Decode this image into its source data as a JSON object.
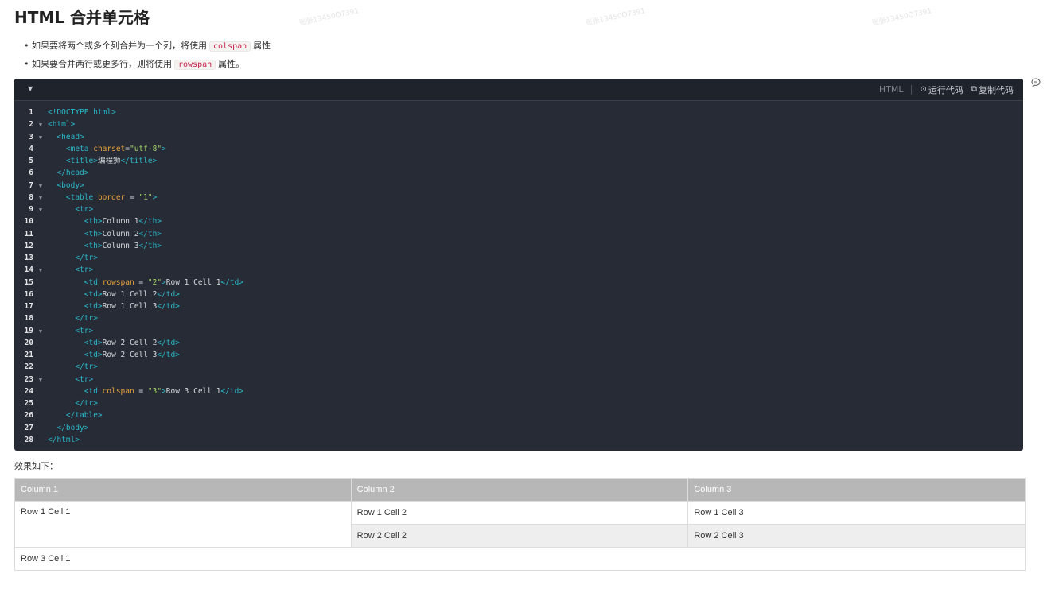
{
  "page": {
    "title": "HTML 合并单元格",
    "bullets": [
      {
        "prefix": "如果要将两个或多个列合并为一个列，将使用",
        "code": "colspan",
        "suffix": "属性"
      },
      {
        "prefix": "如果要合并两行或更多行，则将使用",
        "code": "rowspan",
        "suffix": "属性。"
      }
    ],
    "effect_label": "效果如下："
  },
  "code_block": {
    "language": "HTML",
    "run_label": "运行代码",
    "copy_label": "复制代码",
    "lines": [
      {
        "n": "1",
        "fold": false,
        "indent": "",
        "tokens": [
          {
            "t": "doct",
            "v": "<!DOCTYPE html>"
          }
        ]
      },
      {
        "n": "2",
        "fold": true,
        "indent": "",
        "tokens": [
          {
            "t": "tag",
            "v": "<html>"
          }
        ]
      },
      {
        "n": "3",
        "fold": true,
        "indent": "  ",
        "tokens": [
          {
            "t": "tag",
            "v": "<head>"
          }
        ]
      },
      {
        "n": "4",
        "fold": false,
        "indent": "    ",
        "tokens": [
          {
            "t": "tag",
            "v": "<meta "
          },
          {
            "t": "attr",
            "v": "charset"
          },
          {
            "t": "ct",
            "v": "="
          },
          {
            "t": "str",
            "v": "\"utf-8\""
          },
          {
            "t": "tag",
            "v": ">"
          }
        ]
      },
      {
        "n": "5",
        "fold": false,
        "indent": "    ",
        "tokens": [
          {
            "t": "tag",
            "v": "<title>"
          },
          {
            "t": "ct",
            "v": "编程狮"
          },
          {
            "t": "tag",
            "v": "</title>"
          }
        ]
      },
      {
        "n": "6",
        "fold": false,
        "indent": "  ",
        "tokens": [
          {
            "t": "tag",
            "v": "</head>"
          }
        ]
      },
      {
        "n": "7",
        "fold": true,
        "indent": "  ",
        "tokens": [
          {
            "t": "tag",
            "v": "<body>"
          }
        ]
      },
      {
        "n": "8",
        "fold": true,
        "indent": "    ",
        "tokens": [
          {
            "t": "tag",
            "v": "<table "
          },
          {
            "t": "attr",
            "v": "border"
          },
          {
            "t": "ct",
            "v": " = "
          },
          {
            "t": "str",
            "v": "\"1\""
          },
          {
            "t": "tag",
            "v": ">"
          }
        ]
      },
      {
        "n": "9",
        "fold": true,
        "indent": "      ",
        "tokens": [
          {
            "t": "tag",
            "v": "<tr>"
          }
        ]
      },
      {
        "n": "10",
        "fold": false,
        "indent": "        ",
        "tokens": [
          {
            "t": "tag",
            "v": "<th>"
          },
          {
            "t": "ct",
            "v": "Column 1"
          },
          {
            "t": "tag",
            "v": "</th>"
          }
        ]
      },
      {
        "n": "11",
        "fold": false,
        "indent": "        ",
        "tokens": [
          {
            "t": "tag",
            "v": "<th>"
          },
          {
            "t": "ct",
            "v": "Column 2"
          },
          {
            "t": "tag",
            "v": "</th>"
          }
        ]
      },
      {
        "n": "12",
        "fold": false,
        "indent": "        ",
        "tokens": [
          {
            "t": "tag",
            "v": "<th>"
          },
          {
            "t": "ct",
            "v": "Column 3"
          },
          {
            "t": "tag",
            "v": "</th>"
          }
        ]
      },
      {
        "n": "13",
        "fold": false,
        "indent": "      ",
        "tokens": [
          {
            "t": "tag",
            "v": "</tr>"
          }
        ]
      },
      {
        "n": "14",
        "fold": true,
        "indent": "      ",
        "tokens": [
          {
            "t": "tag",
            "v": "<tr>"
          }
        ]
      },
      {
        "n": "15",
        "fold": false,
        "indent": "        ",
        "tokens": [
          {
            "t": "tag",
            "v": "<td "
          },
          {
            "t": "attr",
            "v": "rowspan"
          },
          {
            "t": "ct",
            "v": " = "
          },
          {
            "t": "str",
            "v": "\"2\""
          },
          {
            "t": "tag",
            "v": ">"
          },
          {
            "t": "ct",
            "v": "Row 1 Cell 1"
          },
          {
            "t": "tag",
            "v": "</td>"
          }
        ]
      },
      {
        "n": "16",
        "fold": false,
        "indent": "        ",
        "tokens": [
          {
            "t": "tag",
            "v": "<td>"
          },
          {
            "t": "ct",
            "v": "Row 1 Cell 2"
          },
          {
            "t": "tag",
            "v": "</td>"
          }
        ]
      },
      {
        "n": "17",
        "fold": false,
        "indent": "        ",
        "tokens": [
          {
            "t": "tag",
            "v": "<td>"
          },
          {
            "t": "ct",
            "v": "Row 1 Cell 3"
          },
          {
            "t": "tag",
            "v": "</td>"
          }
        ]
      },
      {
        "n": "18",
        "fold": false,
        "indent": "      ",
        "tokens": [
          {
            "t": "tag",
            "v": "</tr>"
          }
        ]
      },
      {
        "n": "19",
        "fold": true,
        "indent": "      ",
        "tokens": [
          {
            "t": "tag",
            "v": "<tr>"
          }
        ]
      },
      {
        "n": "20",
        "fold": false,
        "indent": "        ",
        "tokens": [
          {
            "t": "tag",
            "v": "<td>"
          },
          {
            "t": "ct",
            "v": "Row 2 Cell 2"
          },
          {
            "t": "tag",
            "v": "</td>"
          }
        ]
      },
      {
        "n": "21",
        "fold": false,
        "indent": "        ",
        "tokens": [
          {
            "t": "tag",
            "v": "<td>"
          },
          {
            "t": "ct",
            "v": "Row 2 Cell 3"
          },
          {
            "t": "tag",
            "v": "</td>"
          }
        ]
      },
      {
        "n": "22",
        "fold": false,
        "indent": "      ",
        "tokens": [
          {
            "t": "tag",
            "v": "</tr>"
          }
        ]
      },
      {
        "n": "23",
        "fold": true,
        "indent": "      ",
        "tokens": [
          {
            "t": "tag",
            "v": "<tr>"
          }
        ]
      },
      {
        "n": "24",
        "fold": false,
        "indent": "        ",
        "tokens": [
          {
            "t": "tag",
            "v": "<td "
          },
          {
            "t": "attr",
            "v": "colspan"
          },
          {
            "t": "ct",
            "v": " = "
          },
          {
            "t": "str",
            "v": "\"3\""
          },
          {
            "t": "tag",
            "v": ">"
          },
          {
            "t": "ct",
            "v": "Row 3 Cell 1"
          },
          {
            "t": "tag",
            "v": "</td>"
          }
        ]
      },
      {
        "n": "25",
        "fold": false,
        "indent": "      ",
        "tokens": [
          {
            "t": "tag",
            "v": "</tr>"
          }
        ]
      },
      {
        "n": "26",
        "fold": false,
        "indent": "    ",
        "tokens": [
          {
            "t": "tag",
            "v": "</table>"
          }
        ]
      },
      {
        "n": "27",
        "fold": false,
        "indent": "  ",
        "tokens": [
          {
            "t": "tag",
            "v": "</body>"
          }
        ]
      },
      {
        "n": "28",
        "fold": false,
        "indent": "",
        "tokens": [
          {
            "t": "tag",
            "v": "</html>"
          }
        ]
      }
    ]
  },
  "demo_table": {
    "headers": [
      "Column 1",
      "Column 2",
      "Column 3"
    ],
    "r1c1": "Row 1 Cell 1",
    "r1c2": "Row 1 Cell 2",
    "r1c3": "Row 1 Cell 3",
    "r2c2": "Row 2 Cell 2",
    "r2c3": "Row 2 Cell 3",
    "r3c1": "Row 3 Cell 1"
  },
  "watermark_text": "张张13450O7391",
  "colors": {
    "code_bg": "#272b35",
    "tag": "#29b6c8",
    "attr": "#e6a23c",
    "string": "#a6d66a",
    "header_bg": "#b7b7b7"
  }
}
